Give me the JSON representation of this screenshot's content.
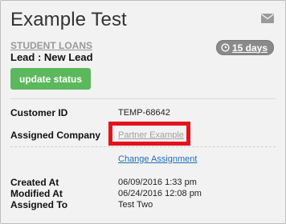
{
  "header": {
    "title": "Example Test",
    "icon": "envelope-icon"
  },
  "lead": {
    "category": "STUDENT LOANS",
    "status_label": "Lead : New Lead",
    "days_badge": "15 days",
    "update_button": "update status"
  },
  "details": {
    "customer_id_label": "Customer ID",
    "customer_id_value": "TEMP-68642",
    "assigned_company_label": "Assigned Company",
    "assigned_company_value": "Partner Example",
    "change_assignment": "Change Assignment",
    "created_label": "Created At",
    "created_value": "06/09/2016 1:33 pm",
    "modified_label": "Modified At",
    "modified_value": "06/24/2016 12:08 pm",
    "assigned_to_label": "Assigned To",
    "assigned_to_value": "Test Two"
  },
  "colors": {
    "accent_button": "#5cb85c",
    "link": "#1f6fb2",
    "highlight": "#e3131c",
    "badge": "#8a8a8a"
  }
}
